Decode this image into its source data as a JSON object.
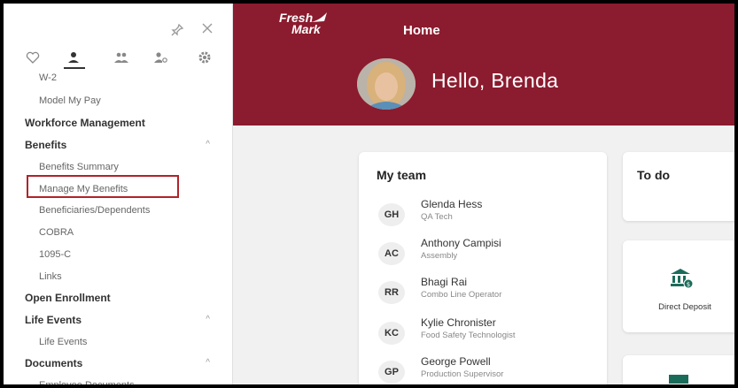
{
  "brand": {
    "logo_line1": "Fresh",
    "logo_line2": "Mark",
    "color": "#8b1b2e"
  },
  "header": {
    "title": "Home",
    "greeting": "Hello, Brenda"
  },
  "sidebar": {
    "menu": [
      {
        "type": "item",
        "label": "W-2"
      },
      {
        "type": "item",
        "label": "Model My Pay"
      },
      {
        "type": "header",
        "label": "Workforce Management"
      },
      {
        "type": "header",
        "label": "Benefits",
        "expanded": true
      },
      {
        "type": "item",
        "label": "Benefits Summary"
      },
      {
        "type": "item",
        "label": "Manage My Benefits",
        "highlighted": true
      },
      {
        "type": "item",
        "label": "Beneficiaries/Dependents"
      },
      {
        "type": "item",
        "label": "COBRA"
      },
      {
        "type": "item",
        "label": "1095-C"
      },
      {
        "type": "item",
        "label": "Links"
      },
      {
        "type": "header",
        "label": "Open Enrollment"
      },
      {
        "type": "header",
        "label": "Life Events",
        "expanded": true
      },
      {
        "type": "item",
        "label": "Life Events"
      },
      {
        "type": "header",
        "label": "Documents",
        "expanded": true
      },
      {
        "type": "item",
        "label": "Employee Documents"
      }
    ],
    "icons": [
      "heart-icon",
      "person-icon",
      "team-icon",
      "person-search-icon",
      "gear-icon"
    ],
    "highlight_color": "#b0232a"
  },
  "team": {
    "title": "My team",
    "members": [
      {
        "initials": "GH",
        "name": "Glenda Hess",
        "role": "QA Tech"
      },
      {
        "initials": "AC",
        "name": "Anthony Campisi",
        "role": "Assembly"
      },
      {
        "initials": "RR",
        "name": "Bhagi Rai",
        "role": "Combo Line Operator"
      },
      {
        "initials": "KC",
        "name": "Kylie Chronister",
        "role": "Food Safety Technologist"
      },
      {
        "initials": "GP",
        "name": "George Powell",
        "role": "Production Supervisor"
      }
    ]
  },
  "todo": {
    "title": "To do"
  },
  "direct_deposit": {
    "label": "Direct Deposit",
    "icon": "bank-icon",
    "icon_color": "#1b6b5a"
  }
}
